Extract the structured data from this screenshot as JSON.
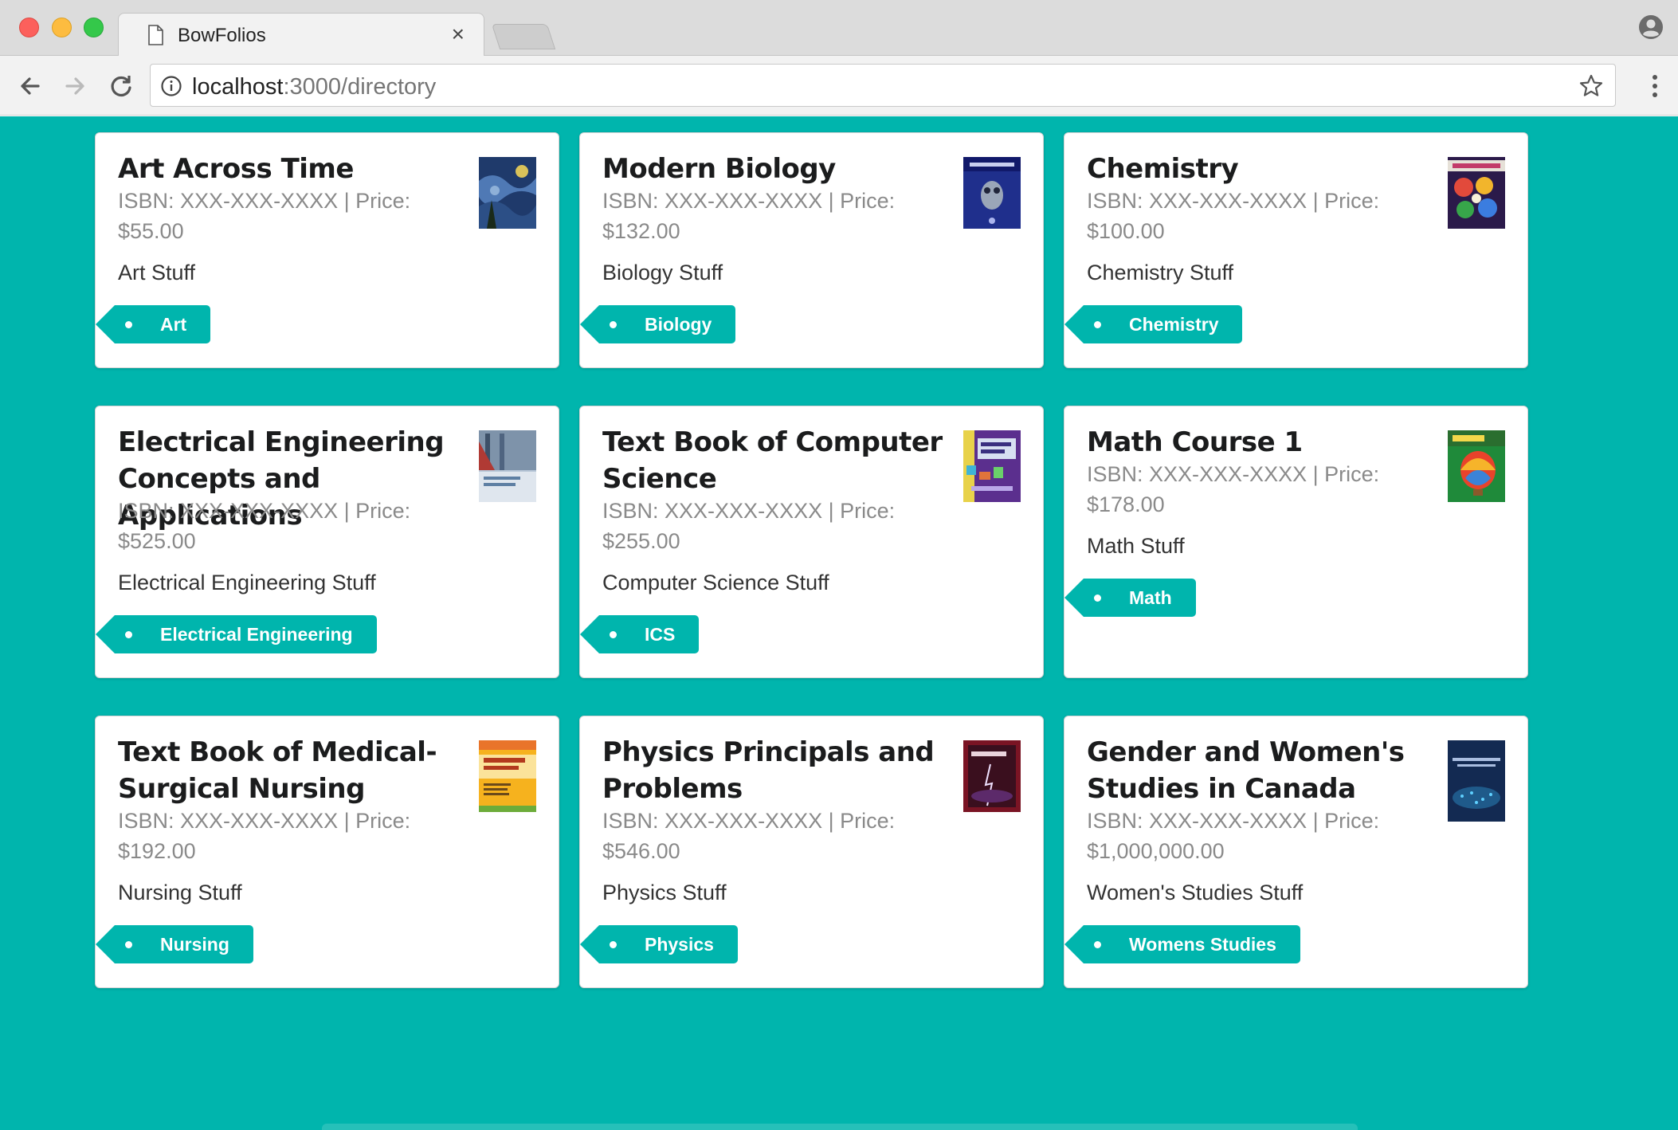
{
  "browser": {
    "tab_title": "BowFolios",
    "tab_close": "×",
    "url_host": "localhost",
    "url_path": ":3000/directory"
  },
  "colors": {
    "page_background": "#00b5ad",
    "tag_background": "#00b5ad"
  },
  "cards": [
    {
      "title": "Art Across Time",
      "isbn_price": "ISBN: XXX-XXX-XXXX | Price: $55.00",
      "description": "Art Stuff",
      "tag": "Art",
      "cover": "art-cover"
    },
    {
      "title": "Modern Biology",
      "isbn_price": "ISBN: XXX-XXX-XXXX | Price: $132.00",
      "description": "Biology Stuff",
      "tag": "Biology",
      "cover": "biology-cover"
    },
    {
      "title": "Chemistry",
      "isbn_price": "ISBN: XXX-XXX-XXXX | Price: $100.00",
      "description": "Chemistry Stuff",
      "tag": "Chemistry",
      "cover": "chemistry-cover"
    },
    {
      "title": "Electrical Engineering Concepts and Applications",
      "isbn_price": "ISBN: XXX-XXX-XXXX | Price: $525.00",
      "description": "Electrical Engineering Stuff",
      "tag": "Electrical Engineering",
      "cover": "electrical-cover"
    },
    {
      "title": "Text Book of Computer Science",
      "isbn_price": "ISBN: XXX-XXX-XXXX | Price: $255.00",
      "description": "Computer Science Stuff",
      "tag": "ICS",
      "cover": "computer-science-cover"
    },
    {
      "title": "Math Course 1",
      "isbn_price": "ISBN: XXX-XXX-XXXX | Price: $178.00",
      "description": "Math Stuff",
      "tag": "Math",
      "cover": "math-cover"
    },
    {
      "title": "Text Book of Medical-Surgical Nursing",
      "isbn_price": "ISBN: XXX-XXX-XXXX | Price: $192.00",
      "description": "Nursing Stuff",
      "tag": "Nursing",
      "cover": "nursing-cover"
    },
    {
      "title": "Physics Principals and Problems",
      "isbn_price": "ISBN: XXX-XXX-XXXX | Price: $546.00",
      "description": "Physics Stuff",
      "tag": "Physics",
      "cover": "physics-cover"
    },
    {
      "title": "Gender and Women's Studies in Canada",
      "isbn_price": "ISBN: XXX-XXX-XXXX | Price: $1,000,000.00",
      "description": "Women's Studies Stuff",
      "tag": "Womens Studies",
      "cover": "womens-studies-cover"
    }
  ],
  "icons": {
    "tab": "document-icon",
    "back": "back-arrow-icon",
    "forward": "forward-arrow-icon",
    "reload": "reload-icon",
    "info": "info-icon",
    "bookmark": "star-icon",
    "menu": "kebab-menu-icon",
    "profile": "profile-icon"
  }
}
